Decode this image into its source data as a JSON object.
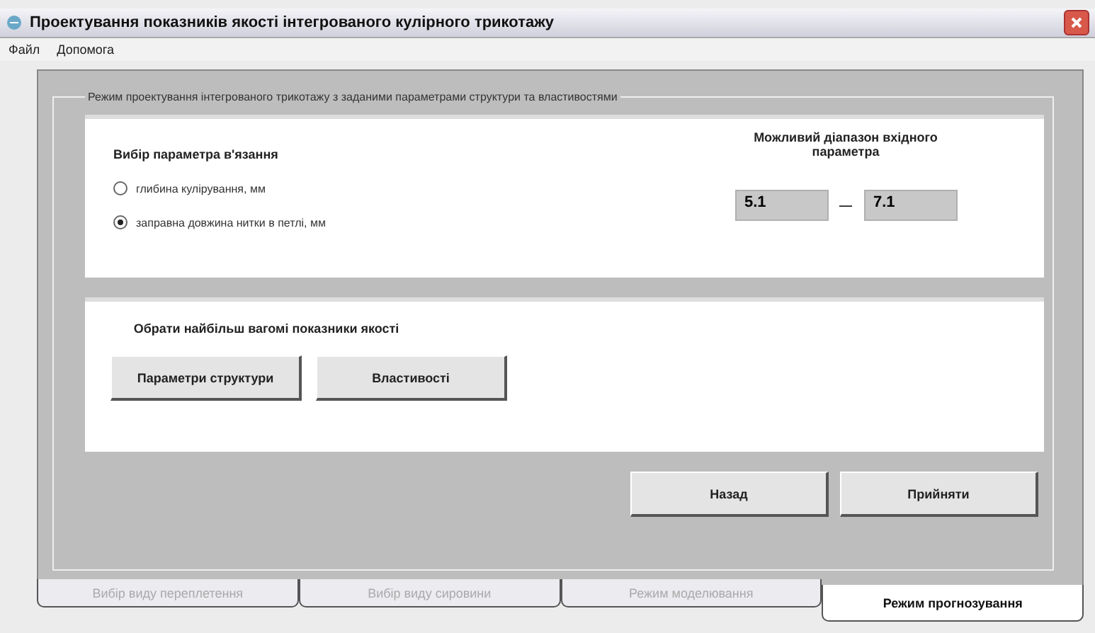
{
  "window": {
    "title": "Проектування показників якості інтегрованого кулірного трикотажу"
  },
  "menu": [
    "Файл",
    "Допомога"
  ],
  "group": {
    "title": "Режим проектування інтегрованого трикотажу з заданими параметрами структури та властивостями",
    "parameter": {
      "heading": "Вибір параметра в'язання",
      "options": [
        {
          "label": "глибина кулірування, мм",
          "selected": false
        },
        {
          "label": "заправна довжина нитки в петлі, мм",
          "selected": true
        }
      ]
    },
    "range": {
      "heading": "Можливий діапазон вхідного параметра",
      "from": "5.1",
      "separator": "—",
      "to": "7.1"
    },
    "quality": {
      "heading": "Обрати найбільш вагомі показники якості",
      "buttons": [
        "Параметри структури",
        "Властивості"
      ]
    },
    "actions": [
      "Назад",
      "Прийняти"
    ]
  },
  "tabs": [
    {
      "label": "Вибір виду переплетення",
      "selected": false,
      "disabled": true
    },
    {
      "label": "Вибір виду сировини",
      "selected": false,
      "disabled": true
    },
    {
      "label": "Режим моделювання",
      "selected": false,
      "disabled": true
    },
    {
      "label": "Режим прогнозування",
      "selected": true,
      "disabled": false
    }
  ]
}
